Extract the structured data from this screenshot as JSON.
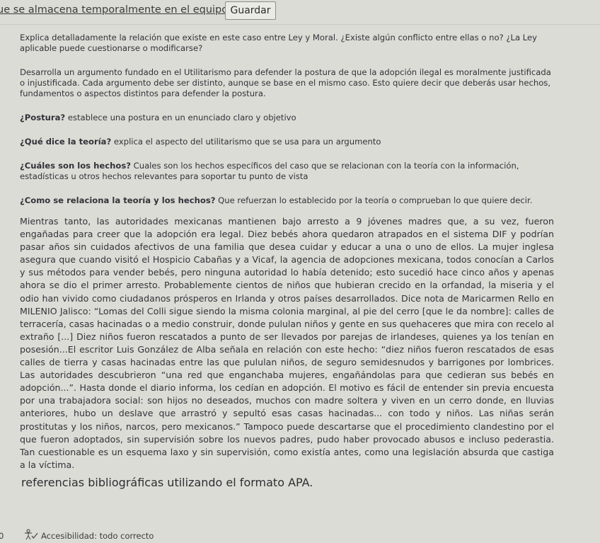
{
  "toolbar": {
    "link_text": "ue se almacena temporalmente en el equipo.",
    "save_label": "Guardar"
  },
  "instructions": {
    "p1": "Explica detalladamente la relación que existe en este caso entre Ley y Moral. ¿Existe algún conflicto entre ellas o no? ¿La Ley aplicable puede cuestionarse o modificarse?",
    "p2": "Desarrolla un argumento fundado en el Utilitarismo para defender la postura de que la adopción ilegal es moralmente justificada o injustificada. Cada argumento debe ser distinto, aunque se base en el mismo caso. Esto quiere decir que deberás usar hechos, fundamentos o aspectos distintos para defender la postura.",
    "q1_bold": "¿Postura?",
    "q1_text": " establece una postura en un enunciado claro y objetivo",
    "q2_bold": "¿Qué dice la teoría?",
    "q2_text": " explica el aspecto del utilitarismo que se usa para un argumento",
    "q3_bold": "¿Cuáles son los hechos?",
    "q3_text": " Cuales son los hechos específicos del caso que se relacionan con la teoría con la información, estadísticas u otros hechos relevantes para soportar tu punto de vista",
    "q4_bold": "¿Como se relaciona la teoría y los hechos?",
    "q4_text": " Que refuerzan lo establecido por la teoría o comprueban lo que quiere decir."
  },
  "main_text": "Mientras tanto, las autoridades mexicanas mantienen bajo arresto a 9 jóvenes madres que, a su vez, fueron engañadas para creer que la adopción era legal. Diez bebés ahora quedaron atrapados en el sistema DIF y podrían pasar años sin cuidados afectivos de una familia que desea cuidar y educar a una o uno de ellos. La mujer inglesa asegura que cuando visitó el Hospicio Cabañas y a Vicaf, la agencia de adopciones mexicana, todos conocían a Carlos y sus métodos para vender bebés, pero ninguna autoridad lo había detenido; esto sucedió hace cinco años y apenas ahora se dio el primer arresto. Probablemente cientos de niños que hubieran crecido en la orfandad, la miseria y el odio han vivido como ciudadanos prósperos en Irlanda y otros países desarrollados. Dice nota de Maricarmen Rello en MILENIO Jalisco: “Lomas del Colli sigue siendo la misma colonia marginal, al pie del cerro [que le da nombre]: calles de terracería, casas hacinadas o a medio construir, donde pululan niños y gente en sus quehaceres que mira con recelo al extraño [...] Diez niños fueron rescatados a punto de ser llevados por parejas de irlandeses, quienes ya los tenían en posesión...El escritor Luis González de Alba señala en relación con este hecho: “diez niños fueron rescatados de esas calles de tierra y casas hacinadas entre las que pululan niños, de seguro semidesnudos y barrigones por lombrices. Las autoridades descubrieron “una red que enganchaba mujeres, engañándolas para que cedieran sus bebés en adopción...”. Hasta donde el diario informa, los cedían en adopción. El motivo es fácil de entender sin previa encuesta por una trabajadora social: son hijos no deseados, muchos con madre soltera y viven en un cerro donde, en lluvias anteriores, hubo un deslave que arrastró y sepultó esas casas hacinadas... con todo y niños. Las niñas serán prostitutas y los niños, narcos, pero mexicanos.” Tampoco puede descartarse que el procedimiento clandestino por el que fueron adoptados, sin supervisión sobre los nuevos padres, pudo haber provocado abusos e incluso pederastia. Tan cuestionable es un esquema laxo y sin supervisión, como existía antes, como una legislación absurda que castiga a la víctima.",
  "references_heading": "referencias bibliográficas utilizando el formato APA.",
  "status": {
    "word_count": "0",
    "accessibility": "Accesibilidad: todo correcto",
    "accessibility_icon": "accessibility-check-icon"
  }
}
